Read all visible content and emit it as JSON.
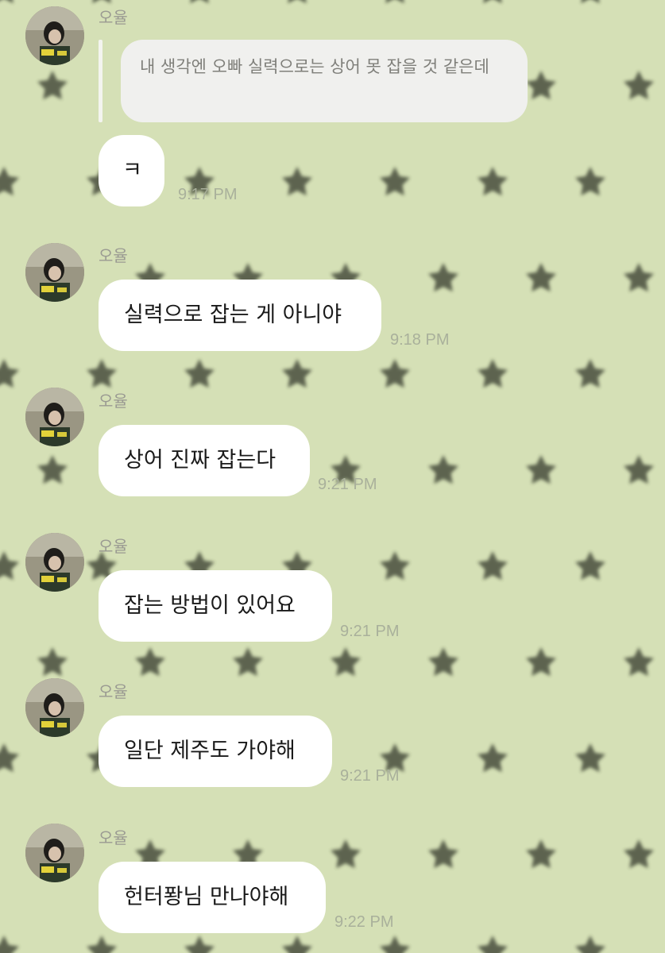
{
  "chat": {
    "background_color": "#d5e0b6",
    "star_color": "#3a3f30",
    "bubble_color": "#ffffff",
    "messages": [
      {
        "sender": "오율",
        "quote": "내 생각엔 오빠 실력으로는 상어 못 잡을 것 같은데",
        "text": "ㅋ",
        "time": "9:17 PM"
      },
      {
        "sender": "오율",
        "text": "실력으로 잡는 게 아니야",
        "time": "9:18 PM"
      },
      {
        "sender": "오율",
        "text": "상어 진짜 잡는다",
        "time": "9:21 PM"
      },
      {
        "sender": "오율",
        "text": "잡는 방법이 있어요",
        "time": "9:21 PM"
      },
      {
        "sender": "오율",
        "text": "일단 제주도 가야해",
        "time": "9:21 PM"
      },
      {
        "sender": "오율",
        "text": "헌터퐝님 만나야해",
        "time": "9:22 PM"
      }
    ]
  }
}
